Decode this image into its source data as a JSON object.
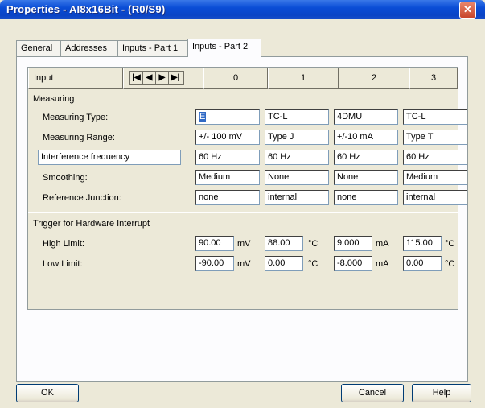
{
  "window": {
    "title": "Properties - AI8x16Bit - (R0/S9)",
    "close_glyph": "✕"
  },
  "tabs": [
    {
      "label": "General"
    },
    {
      "label": "Addresses"
    },
    {
      "label": "Inputs - Part 1"
    },
    {
      "label": "Inputs - Part 2",
      "active": true
    }
  ],
  "grid": {
    "input_label": "Input",
    "nav": [
      "|◀",
      "◀",
      "▶",
      "▶|"
    ],
    "channels": [
      "0",
      "1",
      "2",
      "3"
    ],
    "measuring": {
      "title": "Measuring",
      "rows": {
        "type": {
          "label": "Measuring Type:",
          "values": [
            "E",
            "TC-L",
            "4DMU",
            "TC-L"
          ]
        },
        "range": {
          "label": "Measuring Range:",
          "values": [
            "+/- 100 mV",
            "Type J",
            "+/-10 mA",
            "Type T"
          ]
        },
        "freq": {
          "label": "Interference frequency",
          "values": [
            "60 Hz",
            "60 Hz",
            "60 Hz",
            "60 Hz"
          ]
        },
        "smoothing": {
          "label": "Smoothing:",
          "values": [
            "Medium",
            "None",
            "None",
            "Medium"
          ]
        },
        "junction": {
          "label": "Reference Junction:",
          "values": [
            "none",
            "internal",
            "none",
            "internal"
          ]
        }
      }
    },
    "trigger": {
      "title": "Trigger for Hardware Interrupt",
      "high": {
        "label": "High Limit:",
        "values": [
          "90.00",
          "88.00",
          "9.000",
          "115.00"
        ],
        "units": [
          "mV",
          "°C",
          "mA",
          "°C"
        ]
      },
      "low": {
        "label": "Low Limit:",
        "values": [
          "-90.00",
          "0.00",
          "-8.000",
          "0.00"
        ],
        "units": [
          "mV",
          "°C",
          "mA",
          "°C"
        ]
      }
    }
  },
  "buttons": {
    "ok": "OK",
    "cancel": "Cancel",
    "help": "Help"
  }
}
